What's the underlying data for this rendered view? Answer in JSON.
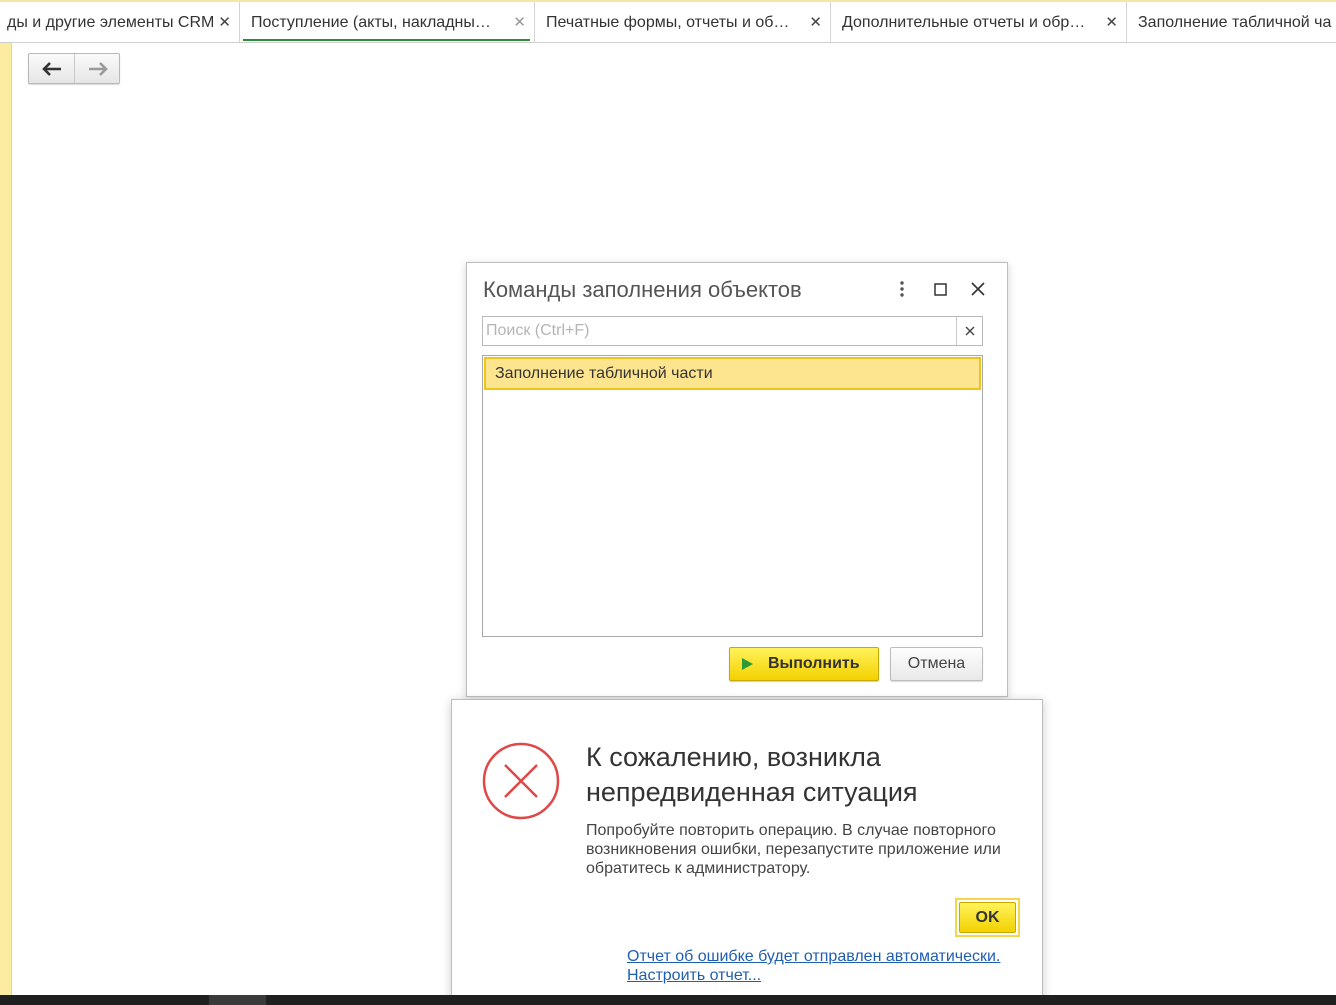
{
  "tabs": [
    {
      "label": "ды и другие элементы CRM",
      "active": false
    },
    {
      "label": "Поступление (акты, накладны…",
      "active": true
    },
    {
      "label": "Печатные формы, отчеты и об…",
      "active": false
    },
    {
      "label": "Дополнительные отчеты и обр…",
      "active": false
    },
    {
      "label": "Заполнение табличной ча",
      "active": false
    }
  ],
  "tab_close_glyph": "✕",
  "nav": {
    "back_icon": "arrow-left-icon",
    "forward_icon": "arrow-right-icon"
  },
  "fill_dialog": {
    "title": "Команды заполнения объектов",
    "search_placeholder": "Поиск (Ctrl+F)",
    "search_value": "",
    "items": [
      {
        "label": "Заполнение табличной части",
        "selected": true
      }
    ],
    "run_label": "Выполнить",
    "cancel_label": "Отмена"
  },
  "error_dialog": {
    "title": "К сожалению, возникла непредвиденная ситуация",
    "message": "Попробуйте повторить операцию. В случае повторного возникновения ошибки, перезапустите приложение или обратитесь к администратору.",
    "ok_label": "OK",
    "link_auto_report": "Отчет об ошибке будет отправлен автоматически.",
    "link_configure": "Настроить отчет..."
  },
  "colors": {
    "accent_yellow": "#f3d100",
    "selection": "#fde48e",
    "error_red": "#e04848",
    "link": "#1f5fb0",
    "active_tab_underline": "#2e8b3d"
  }
}
